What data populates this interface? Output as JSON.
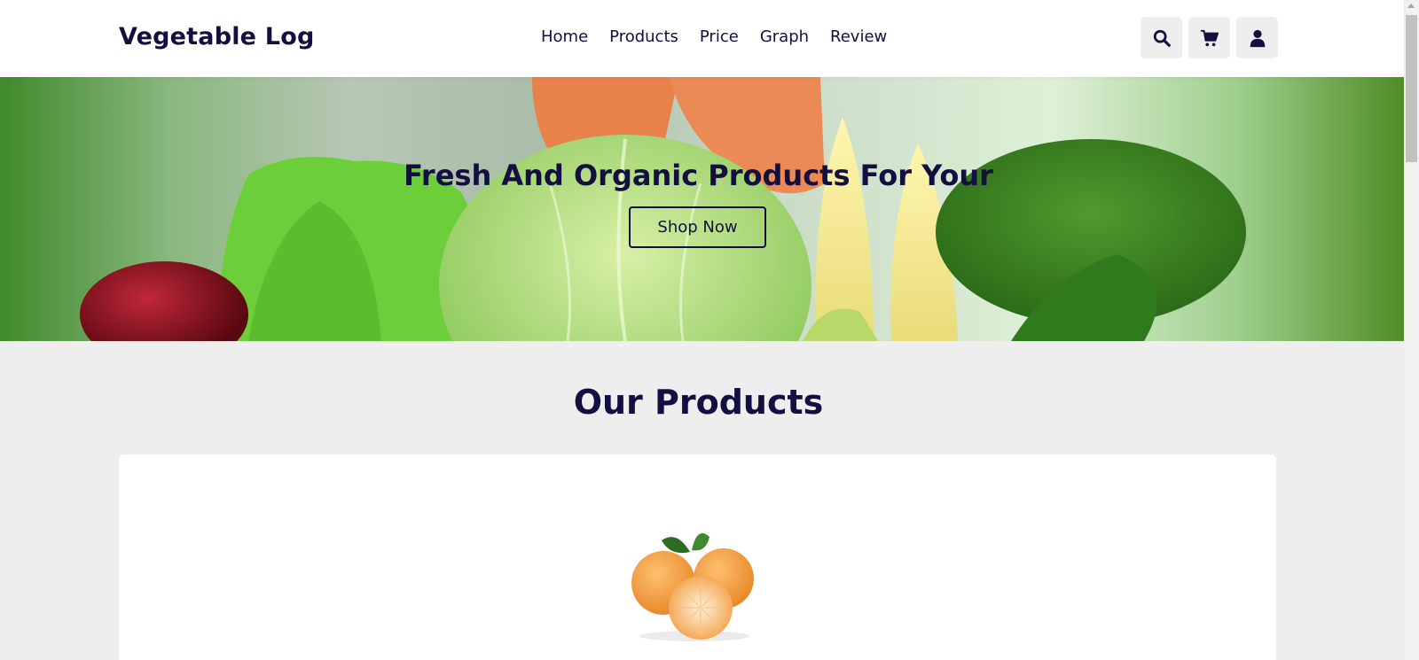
{
  "header": {
    "logo": "Vegetable Log",
    "nav": [
      {
        "label": "Home"
      },
      {
        "label": "Products"
      },
      {
        "label": "Price"
      },
      {
        "label": "Graph"
      },
      {
        "label": "Review"
      }
    ],
    "icons": [
      "search-icon",
      "cart-icon",
      "user-icon"
    ]
  },
  "hero": {
    "title": "Fresh And Organic Products For Your",
    "button_label": "Shop Now"
  },
  "products": {
    "section_title": "Our Products",
    "card_image": "orange-fruit-image"
  },
  "colors": {
    "primary_text": "#130f40",
    "page_background": "#eeeeee",
    "card_background": "#ffffff"
  }
}
